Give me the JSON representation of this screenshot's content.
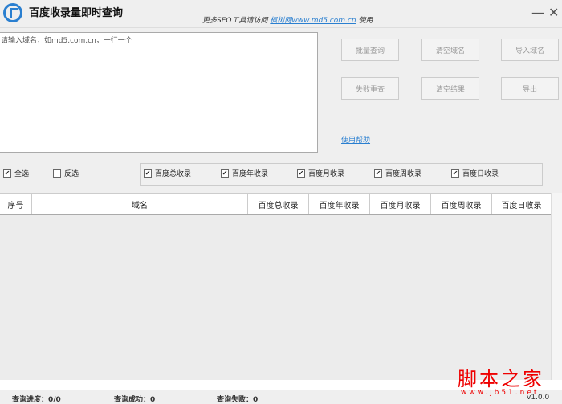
{
  "app": {
    "title": "百度收录量即时查询",
    "promo_prefix": "更多SEO工具请访问",
    "promo_link": "枫树网www.md5.com.cn",
    "promo_suffix": "使用"
  },
  "input": {
    "placeholder": "请输入域名，如md5.com.cn，一行一个",
    "value": ""
  },
  "buttons": {
    "batch_query": "批量查询",
    "clear_domains": "清空域名",
    "import_domains": "导入域名",
    "retry_failed": "失败重查",
    "clear_results": "清空结果",
    "export": "导出"
  },
  "help_link": "使用帮助",
  "select": {
    "all": "全选",
    "invert": "反选"
  },
  "options": [
    {
      "label": "百度总收录",
      "checked": true
    },
    {
      "label": "百度年收录",
      "checked": true
    },
    {
      "label": "百度月收录",
      "checked": true
    },
    {
      "label": "百度周收录",
      "checked": true
    },
    {
      "label": "百度日收录",
      "checked": true
    }
  ],
  "table": {
    "columns": [
      "序号",
      "域名",
      "百度总收录",
      "百度年收录",
      "百度月收录",
      "百度周收录",
      "百度日收录"
    ],
    "rows": []
  },
  "status": {
    "progress": "查询进度：0/0",
    "success": "查询成功：0",
    "fail": "查询失败：0",
    "version": "v1.0.0"
  },
  "watermark": {
    "text": "脚本之家",
    "url": "www.jb51.net"
  }
}
